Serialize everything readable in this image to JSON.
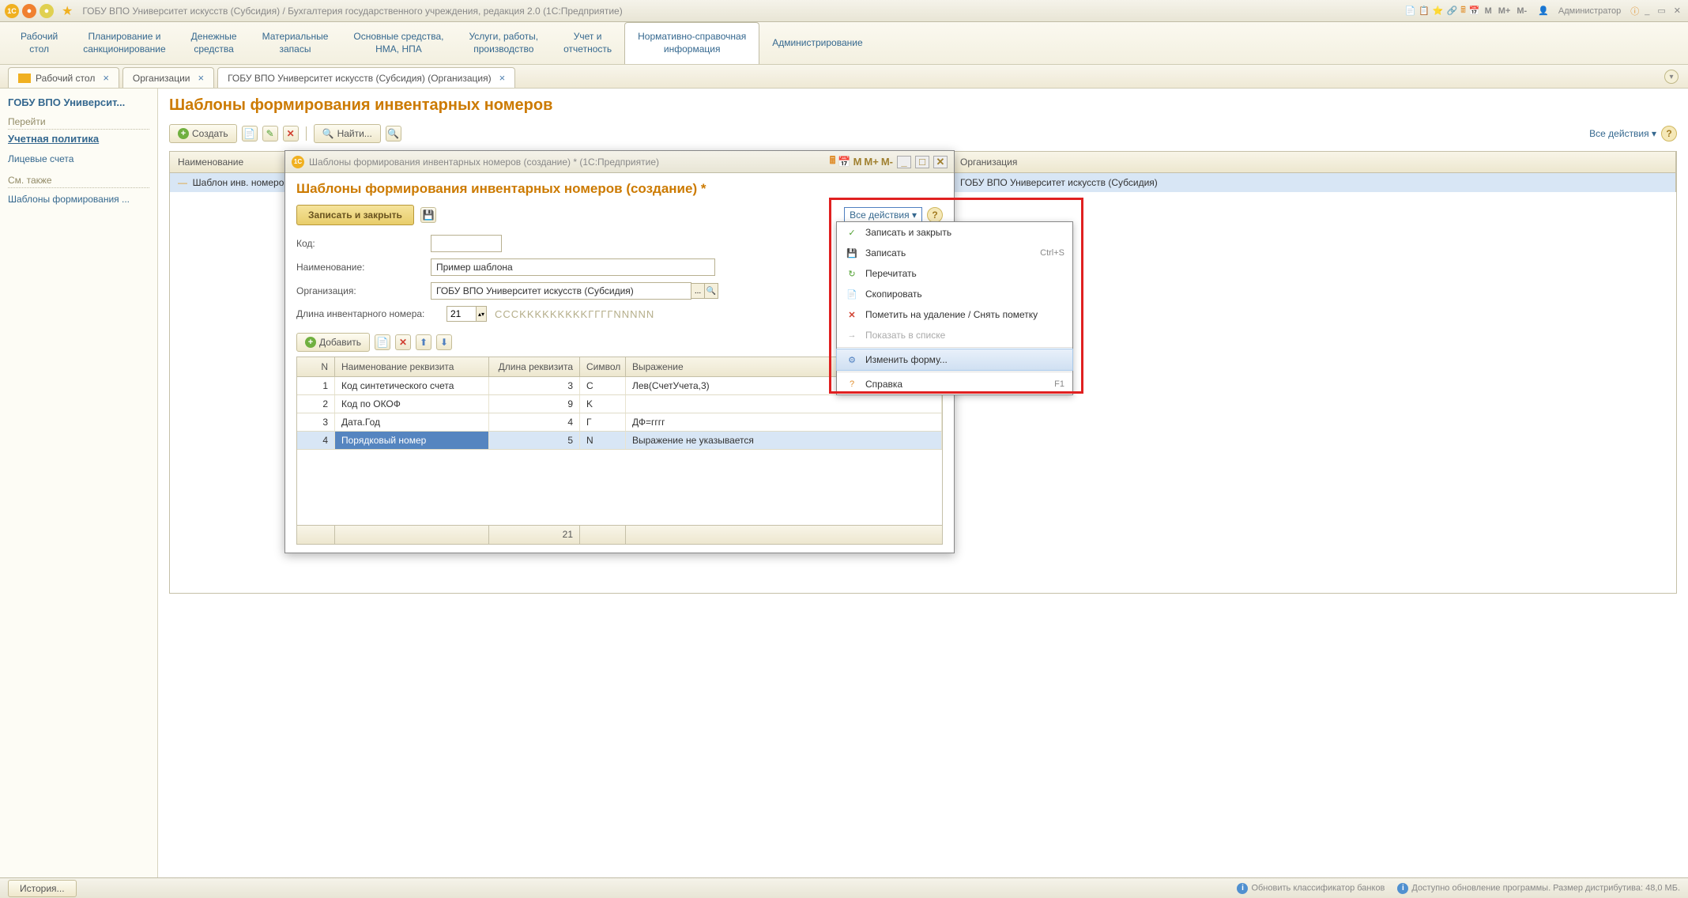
{
  "titlebar": {
    "title": "ГОБУ ВПО Университет искусств (Субсидия) / Бухгалтерия государственного учреждения, редакция 2.0  (1С:Предприятие)",
    "m": "M",
    "mplus": "M+",
    "mminus": "M-",
    "user": "Администратор"
  },
  "sections": [
    {
      "l1": "Рабочий",
      "l2": "стол"
    },
    {
      "l1": "Планирование и",
      "l2": "санкционирование"
    },
    {
      "l1": "Денежные",
      "l2": "средства"
    },
    {
      "l1": "Материальные",
      "l2": "запасы"
    },
    {
      "l1": "Основные средства,",
      "l2": "НМА, НПА"
    },
    {
      "l1": "Услуги, работы,",
      "l2": "производство"
    },
    {
      "l1": "Учет и",
      "l2": "отчетность"
    },
    {
      "l1": "Нормативно-справочная",
      "l2": "информация"
    },
    {
      "l1": "Администрирование",
      "l2": ""
    }
  ],
  "opentabs": [
    {
      "label": "Рабочий стол"
    },
    {
      "label": "Организации"
    },
    {
      "label": "ГОБУ ВПО Университет искусств (Субсидия) (Организация)"
    }
  ],
  "sidebar": {
    "org": "ГОБУ ВПО Университ...",
    "goto": "Перейти",
    "policy": "Учетная политика",
    "accounts": "Лицевые счета",
    "seealso": "См. также",
    "templates": "Шаблоны формирования ..."
  },
  "page": {
    "title": "Шаблоны формирования инвентарных номеров",
    "create": "Создать",
    "find": "Найти...",
    "all_actions": "Все действия"
  },
  "bg_grid": {
    "col1": "Наименование",
    "col2": "Организация",
    "row_name": "Шаблон инв. номеров",
    "row_org": "ГОБУ ВПО Университет искусств (Субсидия)"
  },
  "modal": {
    "title": "Шаблоны формирования инвентарных номеров (создание) *  (1С:Предприятие)",
    "heading": "Шаблоны формирования инвентарных номеров (создание) *",
    "save_close": "Записать и закрыть",
    "all_actions": "Все действия",
    "code_label": "Код:",
    "code_value": "",
    "name_label": "Наименование:",
    "name_value": "Пример шаблона",
    "org_label": "Организация:",
    "org_value": "ГОБУ ВПО Университет искусств (Субсидия)",
    "len_label": "Длина инвентарного номера:",
    "len_value": "21",
    "mask": "CCCKKKKKKKKKГГГГNNNNN",
    "add": "Добавить",
    "m": "M",
    "mplus": "M+",
    "mminus": "M-"
  },
  "inner_grid": {
    "headers": {
      "n": "N",
      "name": "Наименование реквизита",
      "len": "Длина реквизита",
      "sym": "Символ",
      "expr": "Выражение"
    },
    "rows": [
      {
        "n": "1",
        "name": "Код синтетического счета",
        "len": "3",
        "sym": "C",
        "expr": "Лев(СчетУчета,3)"
      },
      {
        "n": "2",
        "name": "Код по ОКОФ",
        "len": "9",
        "sym": "K",
        "expr": ""
      },
      {
        "n": "3",
        "name": "Дата.Год",
        "len": "4",
        "sym": "Г",
        "expr": "ДФ=гггг"
      },
      {
        "n": "4",
        "name": "Порядковый номер",
        "len": "5",
        "sym": "N",
        "expr": "Выражение не указывается"
      }
    ],
    "footer_len": "21"
  },
  "dropdown": [
    {
      "icon": "✓",
      "iconClass": "icon-green",
      "label": "Записать и закрыть",
      "shortcut": ""
    },
    {
      "icon": "💾",
      "iconClass": "icon-save",
      "label": "Записать",
      "shortcut": "Ctrl+S"
    },
    {
      "icon": "↻",
      "iconClass": "icon-green",
      "label": "Перечитать",
      "shortcut": ""
    },
    {
      "icon": "📄",
      "iconClass": "icon-green",
      "label": "Скопировать",
      "shortcut": ""
    },
    {
      "icon": "✕",
      "iconClass": "icon-red",
      "label": "Пометить на удаление / Снять пометку",
      "shortcut": ""
    },
    {
      "icon": "→",
      "iconClass": "",
      "label": "Показать в списке",
      "shortcut": "",
      "disabled": true
    },
    {
      "icon": "⚙",
      "iconClass": "icon-blue",
      "label": "Изменить форму...",
      "shortcut": "",
      "hover": true
    },
    {
      "icon": "?",
      "iconClass": "icon-orange",
      "label": "Справка",
      "shortcut": "F1"
    }
  ],
  "statusbar": {
    "history": "История...",
    "banks": "Обновить классификатор банков",
    "update": "Доступно обновление программы. Размер дистрибутива: 48,0 МБ."
  }
}
